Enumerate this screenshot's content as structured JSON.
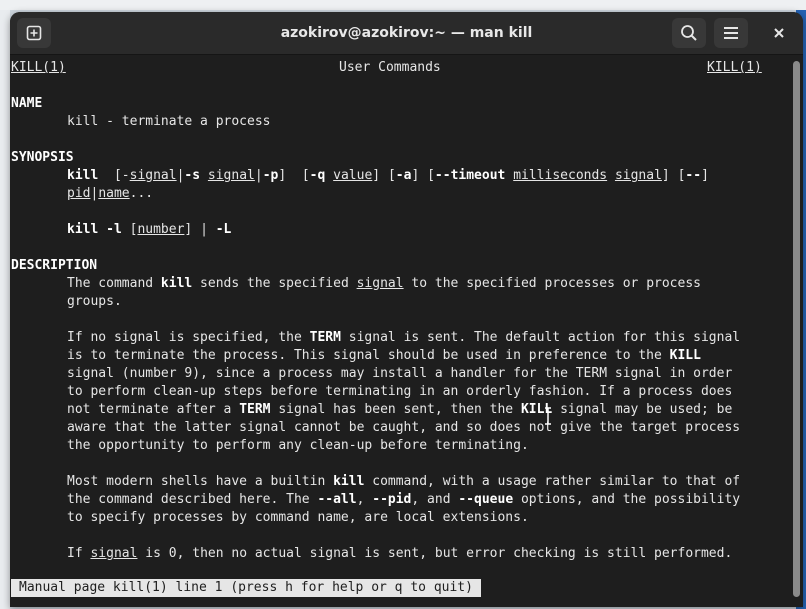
{
  "window": {
    "title": "azokirov@azokirov:~ — man kill"
  },
  "icons": {
    "new_tab": "new-tab-icon",
    "search": "search-icon",
    "menu": "hamburger-menu-icon",
    "close": "close-icon"
  },
  "man": {
    "header_left": "KILL(1)",
    "header_center": "User Commands",
    "header_right": "KILL(1)",
    "name_heading": "NAME",
    "name_line": "kill - terminate a process",
    "synopsis_heading": "SYNOPSIS",
    "description_heading": "DESCRIPTION",
    "status_line": "Manual page kill(1) line 1 (press h for help or q to quit)"
  }
}
